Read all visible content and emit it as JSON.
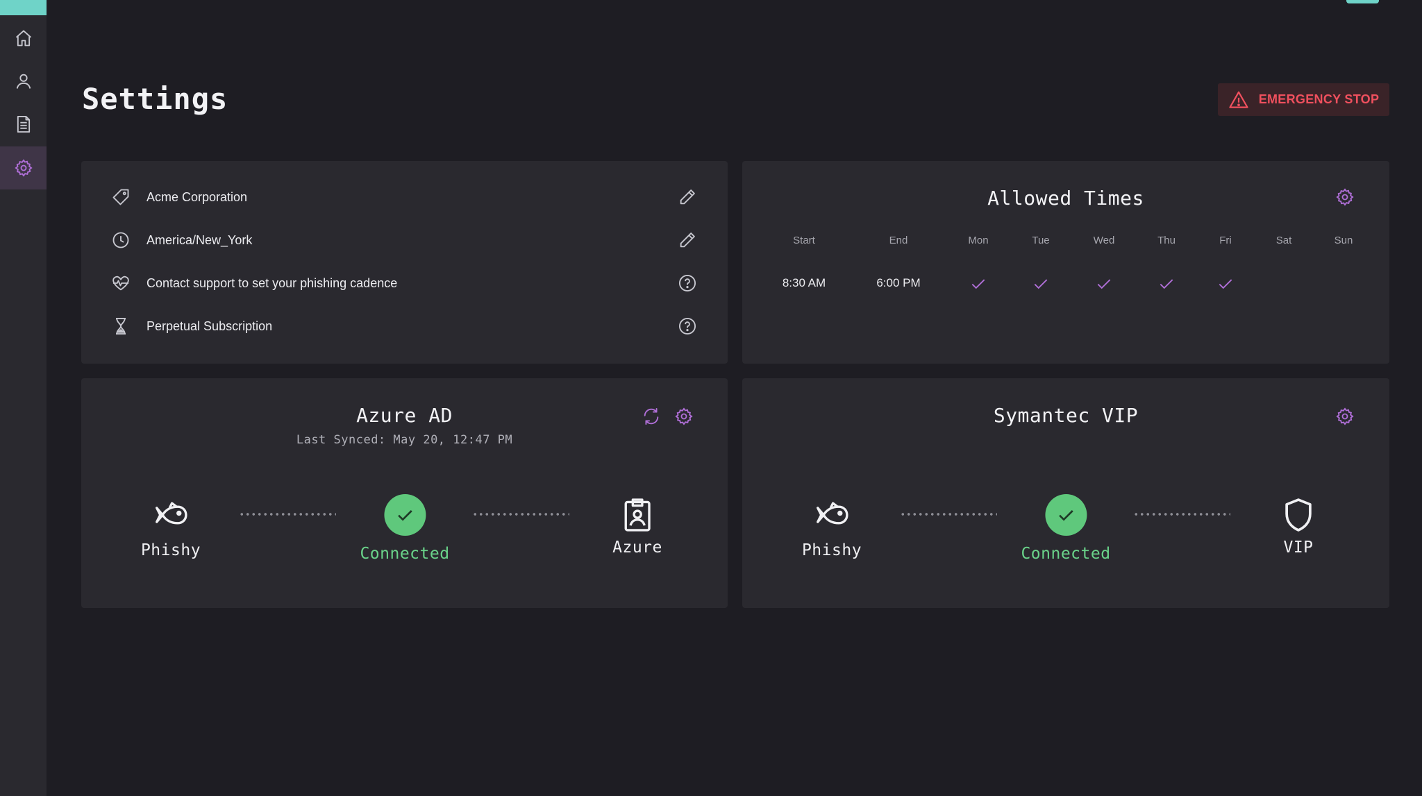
{
  "header": {
    "title": "Settings",
    "emergency_stop_label": "EMERGENCY STOP"
  },
  "sidebar": {
    "items": [
      {
        "name": "home",
        "icon": "home-icon",
        "active": false
      },
      {
        "name": "users",
        "icon": "user-icon",
        "active": false
      },
      {
        "name": "reports",
        "icon": "document-icon",
        "active": false
      },
      {
        "name": "settings",
        "icon": "gear-icon",
        "active": true
      }
    ]
  },
  "info": {
    "rows": [
      {
        "icon": "tag-icon",
        "label": "Acme Corporation",
        "action": "edit-icon"
      },
      {
        "icon": "clock-icon",
        "label": "America/New_York",
        "action": "edit-icon"
      },
      {
        "icon": "heartbeat-icon",
        "label": "Contact support to set your phishing cadence",
        "action": "help-icon"
      },
      {
        "icon": "hourglass-icon",
        "label": "Perpetual Subscription",
        "action": "help-icon"
      }
    ]
  },
  "allowed_times": {
    "title": "Allowed Times",
    "headers": [
      "Start",
      "End",
      "Mon",
      "Tue",
      "Wed",
      "Thu",
      "Fri",
      "Sat",
      "Sun"
    ],
    "start": "8:30 AM",
    "end": "6:00 PM",
    "days_checked": [
      true,
      true,
      true,
      true,
      true,
      false,
      false
    ]
  },
  "azure": {
    "title": "Azure AD",
    "last_synced": "Last Synced: May 20, 12:47 PM",
    "left_node": "Phishy",
    "status": "Connected",
    "right_node": "Azure"
  },
  "vip": {
    "title": "Symantec VIP",
    "left_node": "Phishy",
    "status": "Connected",
    "right_node": "VIP"
  },
  "colors": {
    "accent": "#b06fd8",
    "teal": "#6fd3c8",
    "success": "#5fc87c",
    "danger": "#f0505e"
  }
}
